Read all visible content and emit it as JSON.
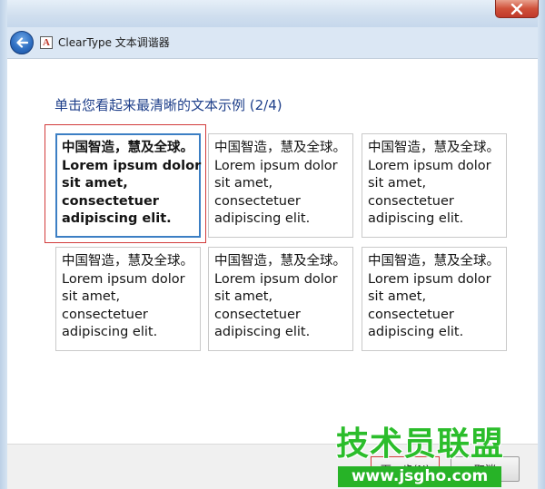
{
  "window": {
    "title": "ClearType 文本调谐器",
    "app_icon_glyph": "A"
  },
  "main": {
    "heading": "单击您看起来最清晰的文本示例 (2/4)",
    "samples": [
      {
        "lines": [
          "中国智造，慧及全球。",
          "Lorem ipsum dolor",
          "sit amet,",
          "consectetuer",
          "adipiscing elit."
        ],
        "selected": true
      },
      {
        "lines": [
          "中国智造，慧及全球。",
          "Lorem ipsum dolor",
          "sit amet,",
          "consectetuer",
          "adipiscing elit."
        ],
        "selected": false
      },
      {
        "lines": [
          "中国智造，慧及全球。",
          "Lorem ipsum dolor",
          "sit amet,",
          "consectetuer",
          "adipiscing elit."
        ],
        "selected": false
      },
      {
        "lines": [
          "中国智造，慧及全球。",
          "Lorem ipsum dolor",
          "sit amet,",
          "consectetuer",
          "adipiscing elit."
        ],
        "selected": false
      },
      {
        "lines": [
          "中国智造，慧及全球。",
          "Lorem ipsum dolor",
          "sit amet,",
          "consectetuer",
          "adipiscing elit."
        ],
        "selected": false
      },
      {
        "lines": [
          "中国智造，慧及全球。",
          "Lorem ipsum dolor",
          "sit amet,",
          "consectetuer",
          "adipiscing elit."
        ],
        "selected": false
      }
    ]
  },
  "footer": {
    "next_label": "下一步(N)",
    "cancel_label": "取消"
  },
  "watermark": {
    "title": "技术员联盟",
    "url": "www.jsgho.com"
  },
  "colors": {
    "heading": "#1e3f8a",
    "selected_border": "#3c7fc4",
    "highlight_outline": "#d23b3b",
    "watermark_green": "#2bbd2b"
  }
}
